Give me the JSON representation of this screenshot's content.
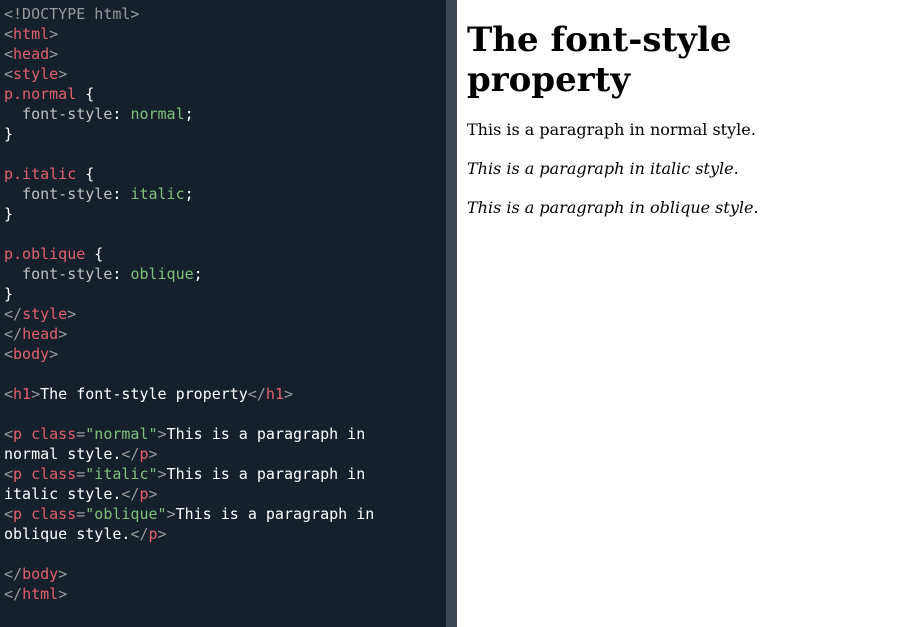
{
  "editor": {
    "lines": [
      {
        "segments": [
          {
            "t": "<!DOCTYPE html>",
            "c": "tk-doctype"
          }
        ]
      },
      {
        "segments": [
          {
            "t": "<",
            "c": "tk-punc"
          },
          {
            "t": "html",
            "c": "tk-tag"
          },
          {
            "t": ">",
            "c": "tk-punc"
          }
        ]
      },
      {
        "segments": [
          {
            "t": "<",
            "c": "tk-punc"
          },
          {
            "t": "head",
            "c": "tk-tag"
          },
          {
            "t": ">",
            "c": "tk-punc"
          }
        ]
      },
      {
        "segments": [
          {
            "t": "<",
            "c": "tk-punc"
          },
          {
            "t": "style",
            "c": "tk-tag"
          },
          {
            "t": ">",
            "c": "tk-punc"
          }
        ]
      },
      {
        "segments": [
          {
            "t": "p.normal",
            "c": "tk-sel"
          },
          {
            "t": " {",
            "c": "tk-brace"
          }
        ]
      },
      {
        "segments": [
          {
            "t": "  font-style",
            "c": "tk-prop"
          },
          {
            "t": ": ",
            "c": "tk-brace"
          },
          {
            "t": "normal",
            "c": "tk-val"
          },
          {
            "t": ";",
            "c": "tk-brace"
          }
        ]
      },
      {
        "segments": [
          {
            "t": "}",
            "c": "tk-brace"
          }
        ]
      },
      {
        "segments": [
          {
            "t": "",
            "c": "tk-text"
          }
        ]
      },
      {
        "segments": [
          {
            "t": "p.italic",
            "c": "tk-sel"
          },
          {
            "t": " {",
            "c": "tk-brace"
          }
        ]
      },
      {
        "segments": [
          {
            "t": "  font-style",
            "c": "tk-prop"
          },
          {
            "t": ": ",
            "c": "tk-brace"
          },
          {
            "t": "italic",
            "c": "tk-val"
          },
          {
            "t": ";",
            "c": "tk-brace"
          }
        ]
      },
      {
        "segments": [
          {
            "t": "}",
            "c": "tk-brace"
          }
        ]
      },
      {
        "segments": [
          {
            "t": "",
            "c": "tk-text"
          }
        ]
      },
      {
        "segments": [
          {
            "t": "p.oblique",
            "c": "tk-sel"
          },
          {
            "t": " {",
            "c": "tk-brace"
          }
        ]
      },
      {
        "segments": [
          {
            "t": "  font-style",
            "c": "tk-prop"
          },
          {
            "t": ": ",
            "c": "tk-brace"
          },
          {
            "t": "oblique",
            "c": "tk-val"
          },
          {
            "t": ";",
            "c": "tk-brace"
          }
        ]
      },
      {
        "segments": [
          {
            "t": "}",
            "c": "tk-brace"
          }
        ]
      },
      {
        "segments": [
          {
            "t": "</",
            "c": "tk-punc"
          },
          {
            "t": "style",
            "c": "tk-tag"
          },
          {
            "t": ">",
            "c": "tk-punc"
          }
        ]
      },
      {
        "segments": [
          {
            "t": "</",
            "c": "tk-punc"
          },
          {
            "t": "head",
            "c": "tk-tag"
          },
          {
            "t": ">",
            "c": "tk-punc"
          }
        ]
      },
      {
        "segments": [
          {
            "t": "<",
            "c": "tk-punc"
          },
          {
            "t": "body",
            "c": "tk-tag"
          },
          {
            "t": ">",
            "c": "tk-punc"
          }
        ]
      },
      {
        "segments": [
          {
            "t": "",
            "c": "tk-text"
          }
        ]
      },
      {
        "segments": [
          {
            "t": "<",
            "c": "tk-punc"
          },
          {
            "t": "h1",
            "c": "tk-tag"
          },
          {
            "t": ">",
            "c": "tk-punc"
          },
          {
            "t": "The font-style property",
            "c": "tk-text"
          },
          {
            "t": "</",
            "c": "tk-punc"
          },
          {
            "t": "h1",
            "c": "tk-tag"
          },
          {
            "t": ">",
            "c": "tk-punc"
          }
        ]
      },
      {
        "segments": [
          {
            "t": "",
            "c": "tk-text"
          }
        ]
      },
      {
        "segments": [
          {
            "t": "<",
            "c": "tk-punc"
          },
          {
            "t": "p",
            "c": "tk-tag"
          },
          {
            "t": " class",
            "c": "tk-attr"
          },
          {
            "t": "=",
            "c": "tk-punc"
          },
          {
            "t": "\"normal\"",
            "c": "tk-str"
          },
          {
            "t": ">",
            "c": "tk-punc"
          },
          {
            "t": "This is a paragraph in",
            "c": "tk-text"
          }
        ]
      },
      {
        "segments": [
          {
            "t": "normal style.",
            "c": "tk-text"
          },
          {
            "t": "</",
            "c": "tk-punc"
          },
          {
            "t": "p",
            "c": "tk-tag"
          },
          {
            "t": ">",
            "c": "tk-punc"
          }
        ]
      },
      {
        "segments": [
          {
            "t": "<",
            "c": "tk-punc"
          },
          {
            "t": "p",
            "c": "tk-tag"
          },
          {
            "t": " class",
            "c": "tk-attr"
          },
          {
            "t": "=",
            "c": "tk-punc"
          },
          {
            "t": "\"italic\"",
            "c": "tk-str"
          },
          {
            "t": ">",
            "c": "tk-punc"
          },
          {
            "t": "This is a paragraph in",
            "c": "tk-text"
          }
        ]
      },
      {
        "segments": [
          {
            "t": "italic style.",
            "c": "tk-text"
          },
          {
            "t": "</",
            "c": "tk-punc"
          },
          {
            "t": "p",
            "c": "tk-tag"
          },
          {
            "t": ">",
            "c": "tk-punc"
          }
        ]
      },
      {
        "segments": [
          {
            "t": "<",
            "c": "tk-punc"
          },
          {
            "t": "p",
            "c": "tk-tag"
          },
          {
            "t": " class",
            "c": "tk-attr"
          },
          {
            "t": "=",
            "c": "tk-punc"
          },
          {
            "t": "\"oblique\"",
            "c": "tk-str"
          },
          {
            "t": ">",
            "c": "tk-punc"
          },
          {
            "t": "This is a paragraph in",
            "c": "tk-text"
          }
        ]
      },
      {
        "segments": [
          {
            "t": "oblique style.",
            "c": "tk-text"
          },
          {
            "t": "</",
            "c": "tk-punc"
          },
          {
            "t": "p",
            "c": "tk-tag"
          },
          {
            "t": ">",
            "c": "tk-punc"
          }
        ]
      },
      {
        "segments": [
          {
            "t": "",
            "c": "tk-text"
          }
        ]
      },
      {
        "segments": [
          {
            "t": "</",
            "c": "tk-punc"
          },
          {
            "t": "body",
            "c": "tk-tag"
          },
          {
            "t": ">",
            "c": "tk-punc"
          }
        ]
      },
      {
        "segments": [
          {
            "t": "</",
            "c": "tk-punc"
          },
          {
            "t": "html",
            "c": "tk-tag"
          },
          {
            "t": ">",
            "c": "tk-punc"
          }
        ]
      }
    ]
  },
  "preview": {
    "heading": "The font-style property",
    "paragraphs": {
      "normal": "This is a paragraph in normal style.",
      "italic": "This is a paragraph in italic style.",
      "oblique": "This is a paragraph in oblique style."
    }
  },
  "colors": {
    "editor_bg": "#16202b",
    "divider": "#3b4650",
    "preview_bg": "#ffffff",
    "tag": "#e1616e",
    "string_value": "#7ec27e"
  }
}
